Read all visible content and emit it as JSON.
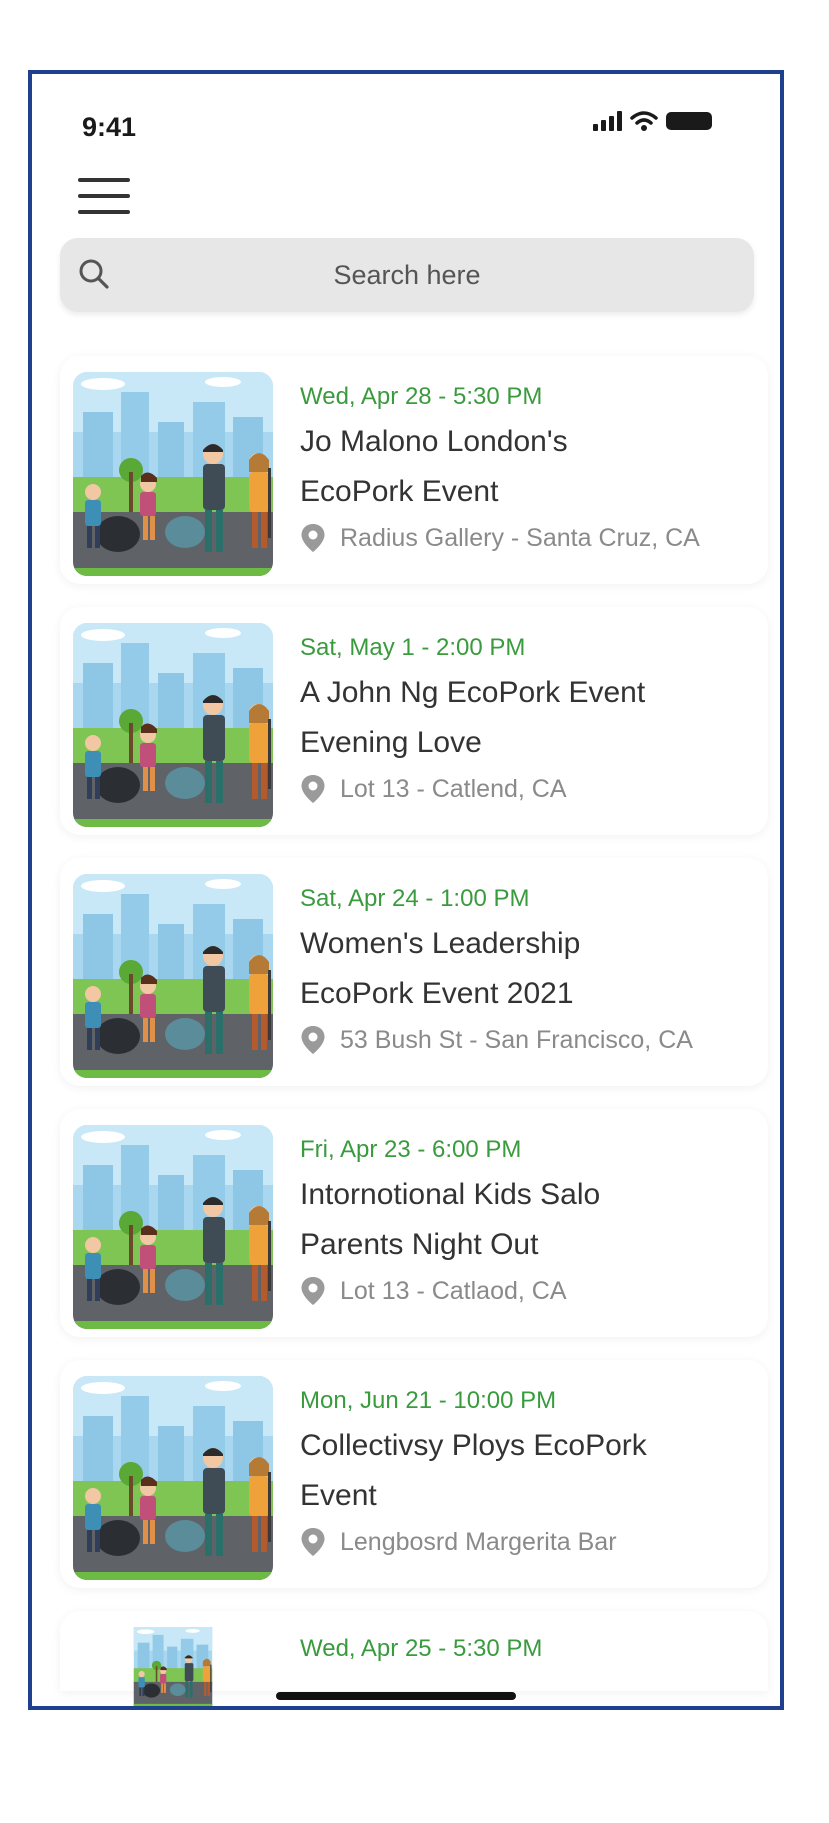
{
  "status_bar": {
    "time": "9:41"
  },
  "search": {
    "placeholder": "Search here"
  },
  "events": [
    {
      "date": "Wed, Apr 28 - 5:30 PM",
      "title_line1": "Jo Malono London's",
      "title_line2": "EcoPork Event",
      "location": "Radius Gallery - Santa Cruz, CA"
    },
    {
      "date": "Sat, May 1 - 2:00 PM",
      "title_line1": "A John Ng EcoPork Event",
      "title_line2": "Evening Love",
      "location": "Lot 13 - Catlend, CA"
    },
    {
      "date": "Sat, Apr 24 - 1:00 PM",
      "title_line1": "Women's Leadership",
      "title_line2": "EcoPork Event 2021",
      "location": "53 Bush St - San Francisco, CA"
    },
    {
      "date": "Fri, Apr 23 - 6:00 PM",
      "title_line1": "Intornotional Kids Salo",
      "title_line2": "Parents Night Out",
      "location": "Lot 13 - Catlaod, CA"
    },
    {
      "date": "Mon, Jun 21 - 10:00 PM",
      "title_line1": "Collectivsy Ploys EcoPork",
      "title_line2": "Event",
      "location": "Lengbosrd Margerita Bar"
    }
  ],
  "partial_event": {
    "date": "Wed, Apr 25 - 5:30 PM"
  },
  "icons": {
    "menu": "hamburger-menu-icon",
    "search": "search-icon",
    "location": "location-pin-icon",
    "signal": "cellular-signal-icon",
    "wifi": "wifi-icon",
    "battery": "battery-icon"
  },
  "colors": {
    "date_green": "#3a9b3e",
    "title": "#333333",
    "location_gray": "#8a8a8a",
    "search_bg": "#e7e7e7",
    "frame_border": "#1f3f8f"
  }
}
